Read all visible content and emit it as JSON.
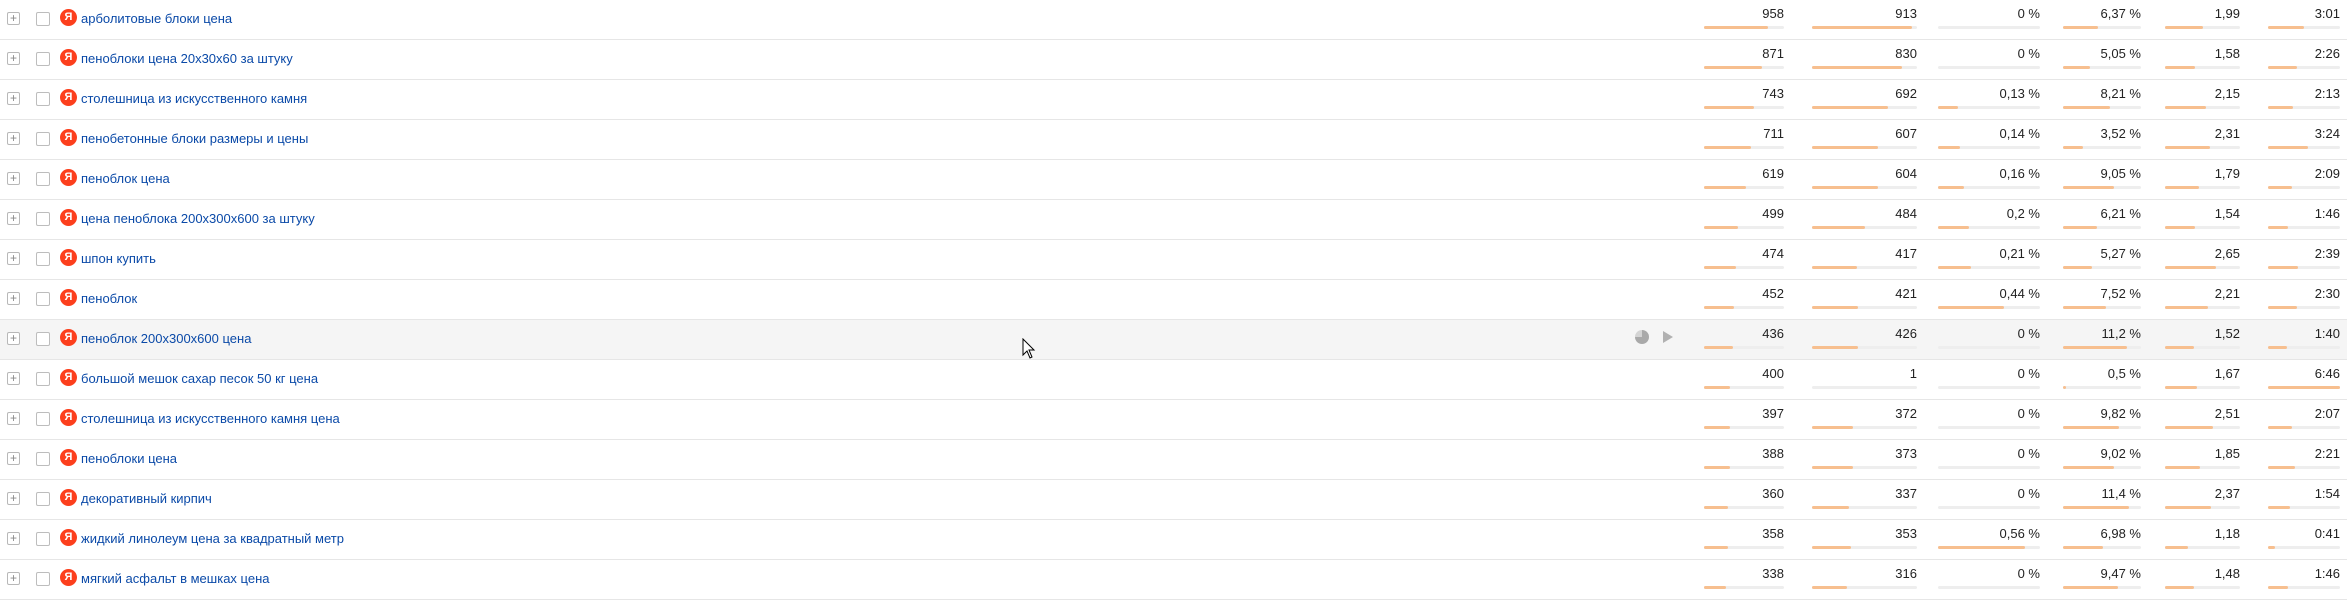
{
  "accent_color": "#fc3f1d",
  "link_color": "#0b4aa8",
  "bar_color": "#f7bf8f",
  "hover_row_index": 8,
  "rows": [
    {
      "keyword": "арболитовые блоки цена",
      "c1": "958",
      "c1_bar": 0.8,
      "c2": "913",
      "c2_bar": 0.95,
      "c3": "0 %",
      "c3_bar": 0.0,
      "c4": "6,37 %",
      "c4_bar": 0.45,
      "c5": "1,99",
      "c5_bar": 0.5,
      "c6": "3:01",
      "c6_bar": 0.5
    },
    {
      "keyword": "пеноблоки цена 20х30х60 за штуку",
      "c1": "871",
      "c1_bar": 0.73,
      "c2": "830",
      "c2_bar": 0.86,
      "c3": "0 %",
      "c3_bar": 0.0,
      "c4": "5,05 %",
      "c4_bar": 0.35,
      "c5": "1,58",
      "c5_bar": 0.4,
      "c6": "2:26",
      "c6_bar": 0.4
    },
    {
      "keyword": "столешница из искусственного камня",
      "c1": "743",
      "c1_bar": 0.62,
      "c2": "692",
      "c2_bar": 0.72,
      "c3": "0,13 %",
      "c3_bar": 0.2,
      "c4": "8,21 %",
      "c4_bar": 0.6,
      "c5": "2,15",
      "c5_bar": 0.55,
      "c6": "2:13",
      "c6_bar": 0.35
    },
    {
      "keyword": "пенобетонные блоки размеры и цены",
      "c1": "711",
      "c1_bar": 0.59,
      "c2": "607",
      "c2_bar": 0.63,
      "c3": "0,14 %",
      "c3_bar": 0.22,
      "c4": "3,52 %",
      "c4_bar": 0.25,
      "c5": "2,31",
      "c5_bar": 0.6,
      "c6": "3:24",
      "c6_bar": 0.55
    },
    {
      "keyword": "пеноблок цена",
      "c1": "619",
      "c1_bar": 0.52,
      "c2": "604",
      "c2_bar": 0.63,
      "c3": "0,16 %",
      "c3_bar": 0.25,
      "c4": "9,05 %",
      "c4_bar": 0.66,
      "c5": "1,79",
      "c5_bar": 0.45,
      "c6": "2:09",
      "c6_bar": 0.34
    },
    {
      "keyword": "цена пеноблока 200х300х600 за штуку",
      "c1": "499",
      "c1_bar": 0.42,
      "c2": "484",
      "c2_bar": 0.5,
      "c3": "0,2 %",
      "c3_bar": 0.3,
      "c4": "6,21 %",
      "c4_bar": 0.44,
      "c5": "1,54",
      "c5_bar": 0.4,
      "c6": "1:46",
      "c6_bar": 0.28
    },
    {
      "keyword": "шпон купить",
      "c1": "474",
      "c1_bar": 0.4,
      "c2": "417",
      "c2_bar": 0.43,
      "c3": "0,21 %",
      "c3_bar": 0.32,
      "c4": "5,27 %",
      "c4_bar": 0.37,
      "c5": "2,65",
      "c5_bar": 0.68,
      "c6": "2:39",
      "c6_bar": 0.42
    },
    {
      "keyword": "пеноблок",
      "c1": "452",
      "c1_bar": 0.38,
      "c2": "421",
      "c2_bar": 0.44,
      "c3": "0,44 %",
      "c3_bar": 0.65,
      "c4": "7,52 %",
      "c4_bar": 0.55,
      "c5": "2,21",
      "c5_bar": 0.57,
      "c6": "2:30",
      "c6_bar": 0.4
    },
    {
      "keyword": "пеноблок 200х300х600 цена",
      "c1": "436",
      "c1_bar": 0.36,
      "c2": "426",
      "c2_bar": 0.44,
      "c3": "0 %",
      "c3_bar": 0.0,
      "c4": "11,2 %",
      "c4_bar": 0.82,
      "c5": "1,52",
      "c5_bar": 0.39,
      "c6": "1:40",
      "c6_bar": 0.27
    },
    {
      "keyword": "большой мешок сахар песок 50 кг цена",
      "c1": "400",
      "c1_bar": 0.33,
      "c2": "1",
      "c2_bar": 0.0,
      "c3": "0 %",
      "c3_bar": 0.0,
      "c4": "0,5 %",
      "c4_bar": 0.04,
      "c5": "1,67",
      "c5_bar": 0.43,
      "c6": "6:46",
      "c6_bar": 1.0
    },
    {
      "keyword": "столешница из искусственного камня цена",
      "c1": "397",
      "c1_bar": 0.33,
      "c2": "372",
      "c2_bar": 0.39,
      "c3": "0 %",
      "c3_bar": 0.0,
      "c4": "9,82 %",
      "c4_bar": 0.72,
      "c5": "2,51",
      "c5_bar": 0.64,
      "c6": "2:07",
      "c6_bar": 0.33
    },
    {
      "keyword": "пеноблоки цена",
      "c1": "388",
      "c1_bar": 0.32,
      "c2": "373",
      "c2_bar": 0.39,
      "c3": "0 %",
      "c3_bar": 0.0,
      "c4": "9,02 %",
      "c4_bar": 0.66,
      "c5": "1,85",
      "c5_bar": 0.47,
      "c6": "2:21",
      "c6_bar": 0.37
    },
    {
      "keyword": "декоративный кирпич",
      "c1": "360",
      "c1_bar": 0.3,
      "c2": "337",
      "c2_bar": 0.35,
      "c3": "0 %",
      "c3_bar": 0.0,
      "c4": "11,4 %",
      "c4_bar": 0.84,
      "c5": "2,37",
      "c5_bar": 0.61,
      "c6": "1:54",
      "c6_bar": 0.3
    },
    {
      "keyword": "жидкий линолеум цена за квадратный метр",
      "c1": "358",
      "c1_bar": 0.3,
      "c2": "353",
      "c2_bar": 0.37,
      "c3": "0,56 %",
      "c3_bar": 0.85,
      "c4": "6,98 %",
      "c4_bar": 0.51,
      "c5": "1,18",
      "c5_bar": 0.3,
      "c6": "0:41",
      "c6_bar": 0.1
    },
    {
      "keyword": "мягкий асфальт в мешках цена",
      "c1": "338",
      "c1_bar": 0.28,
      "c2": "316",
      "c2_bar": 0.33,
      "c3": "0 %",
      "c3_bar": 0.0,
      "c4": "9,47 %",
      "c4_bar": 0.7,
      "c5": "1,48",
      "c5_bar": 0.38,
      "c6": "1:46",
      "c6_bar": 0.28
    }
  ]
}
